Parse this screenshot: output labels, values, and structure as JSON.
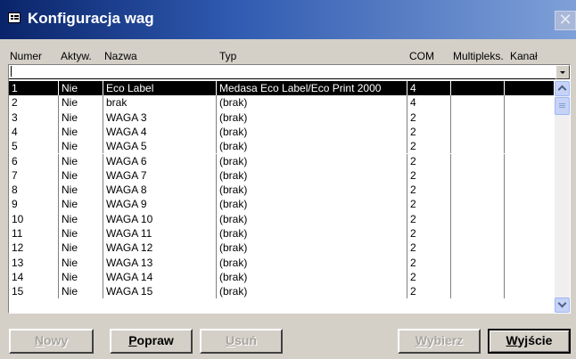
{
  "window": {
    "title": "Konfiguracja wag",
    "close_glyph": "✕"
  },
  "columns": [
    "Numer",
    "Aktyw.",
    "Nazwa",
    "Typ",
    "COM",
    "Multipleks.",
    "Kanał"
  ],
  "filter": {
    "value": ""
  },
  "rows": [
    {
      "num": "1",
      "aktyw": "Nie",
      "nazwa": "Eco Label",
      "typ": "Medasa Eco Label/Eco Print 2000",
      "com": "4",
      "selected": true
    },
    {
      "num": "2",
      "aktyw": "Nie",
      "nazwa": "brak",
      "typ": "(brak)",
      "com": "4"
    },
    {
      "num": "3",
      "aktyw": "Nie",
      "nazwa": "WAGA 3",
      "typ": "(brak)",
      "com": "2"
    },
    {
      "num": "4",
      "aktyw": "Nie",
      "nazwa": "WAGA 4",
      "typ": "(brak)",
      "com": "2"
    },
    {
      "num": "5",
      "aktyw": "Nie",
      "nazwa": "WAGA 5",
      "typ": "(brak)",
      "com": "2"
    },
    {
      "num": "6",
      "aktyw": "Nie",
      "nazwa": "WAGA 6",
      "typ": "(brak)",
      "com": "2"
    },
    {
      "num": "7",
      "aktyw": "Nie",
      "nazwa": "WAGA 7",
      "typ": "(brak)",
      "com": "2"
    },
    {
      "num": "8",
      "aktyw": "Nie",
      "nazwa": "WAGA 8",
      "typ": "(brak)",
      "com": "2"
    },
    {
      "num": "9",
      "aktyw": "Nie",
      "nazwa": "WAGA 9",
      "typ": "(brak)",
      "com": "2"
    },
    {
      "num": "10",
      "aktyw": "Nie",
      "nazwa": "WAGA 10",
      "typ": "(brak)",
      "com": "2"
    },
    {
      "num": "11",
      "aktyw": "Nie",
      "nazwa": "WAGA 11",
      "typ": "(brak)",
      "com": "2"
    },
    {
      "num": "12",
      "aktyw": "Nie",
      "nazwa": "WAGA 12",
      "typ": "(brak)",
      "com": "2"
    },
    {
      "num": "13",
      "aktyw": "Nie",
      "nazwa": "WAGA 13",
      "typ": "(brak)",
      "com": "2"
    },
    {
      "num": "14",
      "aktyw": "Nie",
      "nazwa": "WAGA 14",
      "typ": "(brak)",
      "com": "2"
    },
    {
      "num": "15",
      "aktyw": "Nie",
      "nazwa": "WAGA 15",
      "typ": "(brak)",
      "com": "2"
    }
  ],
  "buttons": {
    "nowy": {
      "label": "Nowy",
      "enabled": false
    },
    "popraw": {
      "label": "Popraw",
      "enabled": true
    },
    "usun": {
      "label": "Usuń",
      "enabled": false
    },
    "wybierz": {
      "label": "Wybierz",
      "enabled": false
    },
    "wyjscie": {
      "label": "Wyjście",
      "enabled": true
    }
  },
  "colors": {
    "title_start": "#0a246a",
    "title_end": "#7fa0d8",
    "face": "#d4d0c8",
    "selection": "#000000"
  },
  "icons": {
    "title": "form-icon",
    "close": "close-icon",
    "dropdown": "chevron-down-icon"
  }
}
